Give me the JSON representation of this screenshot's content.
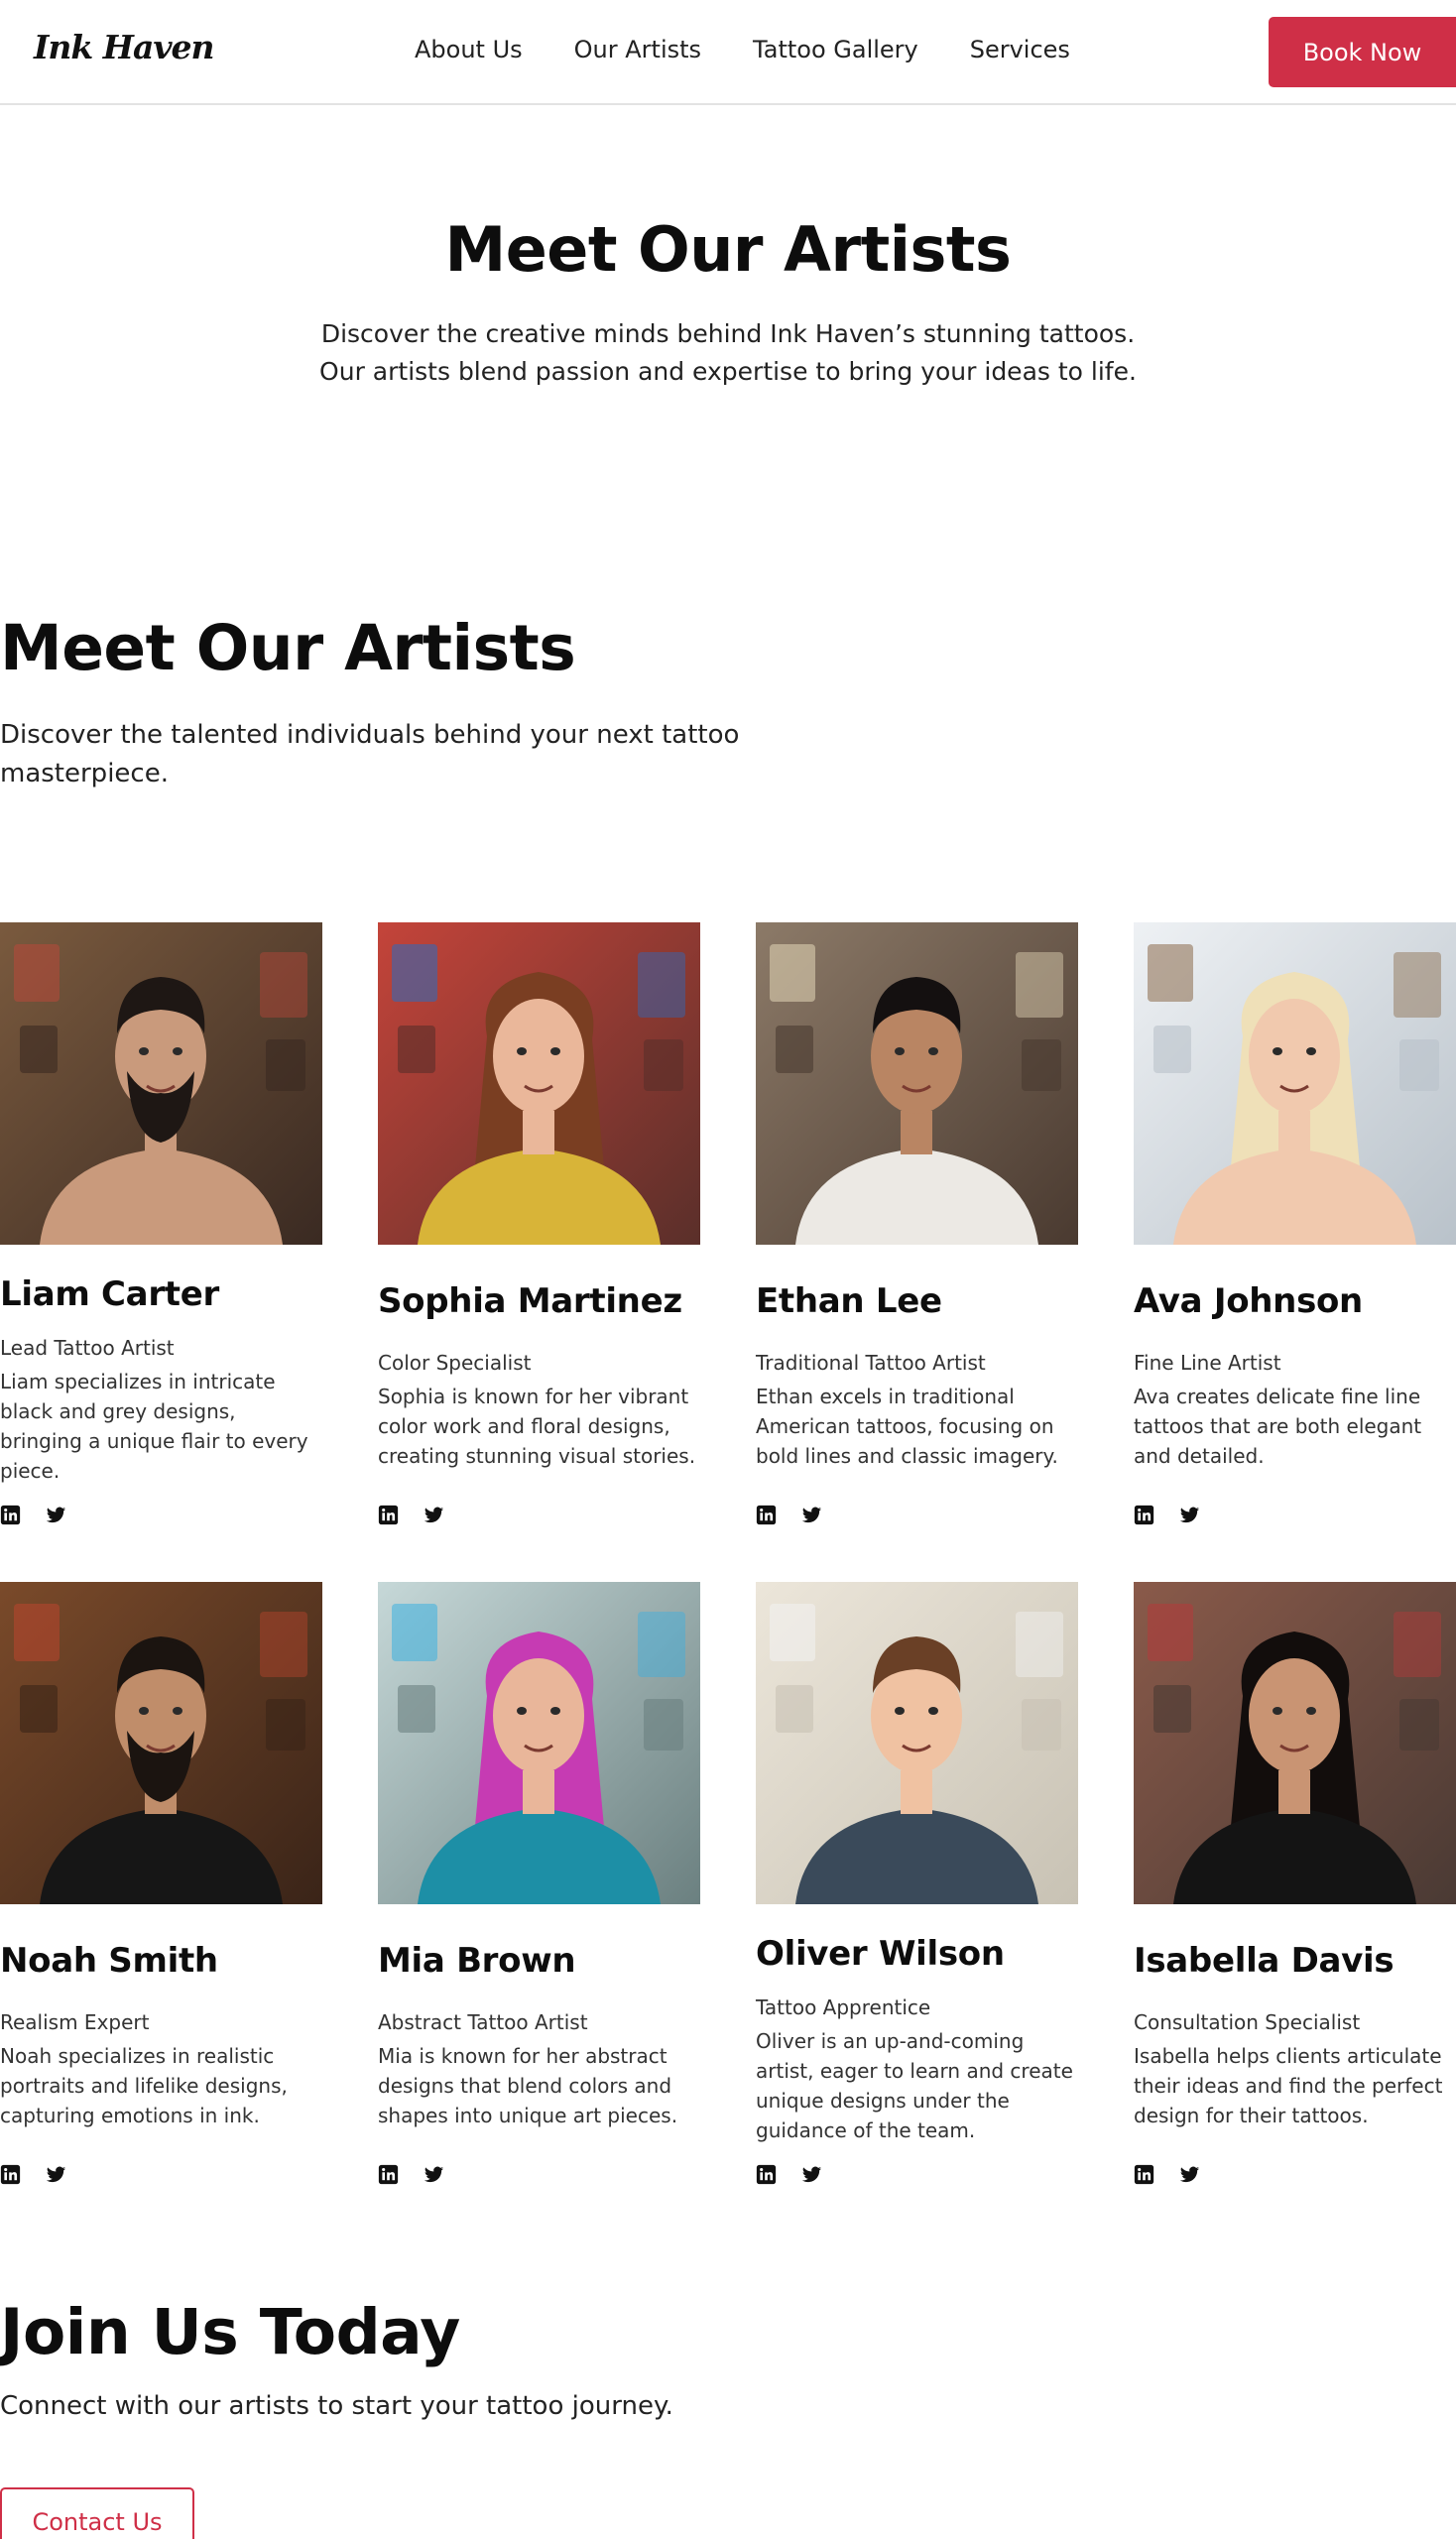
{
  "brand": {
    "logo": "Ink Haven"
  },
  "nav": {
    "links": [
      "About Us",
      "Our Artists",
      "Tattoo Gallery",
      "Services"
    ],
    "cta": "Book Now"
  },
  "hero": {
    "title": "Meet Our Artists",
    "subtitle": "Discover the creative minds behind Ink Haven’s stunning tattoos. Our artists blend passion and expertise to bring your ideas to life."
  },
  "section": {
    "title": "Meet Our Artists",
    "subtitle": "Discover the talented individuals behind your next tattoo masterpiece."
  },
  "artists": [
    {
      "name": "Liam Carter",
      "role": "Lead Tattoo Artist",
      "bio": "Liam specializes in intricate black and grey designs, bringing a unique flair to every piece.",
      "photo": "portrait-bearded-tattooed-man"
    },
    {
      "name": "Sophia Martinez",
      "role": "Color Specialist",
      "bio": "Sophia is known for her vibrant color work and floral designs, creating stunning visual stories.",
      "photo": "portrait-woman-long-wavy-hair"
    },
    {
      "name": "Ethan Lee",
      "role": "Traditional Tattoo Artist",
      "bio": "Ethan excels in traditional American tattoos, focusing on bold lines and classic imagery.",
      "photo": "portrait-smiling-man-tank-top"
    },
    {
      "name": "Ava Johnson",
      "role": "Fine Line Artist",
      "bio": "Ava creates delicate fine line tattoos that are both elegant and detailed.",
      "photo": "portrait-woman-short-blonde-hair"
    },
    {
      "name": "Noah Smith",
      "role": "Realism Expert",
      "bio": "Noah specializes in realistic portraits and lifelike designs, capturing emotions in ink.",
      "photo": "portrait-bearded-man-black-tee"
    },
    {
      "name": "Mia Brown",
      "role": "Abstract Tattoo Artist",
      "bio": "Mia is known for her abstract designs that blend colors and shapes into unique art pieces.",
      "photo": "portrait-woman-pink-blue-hair"
    },
    {
      "name": "Oliver Wilson",
      "role": "Tattoo Apprentice",
      "bio": "Oliver is an up-and-coming artist, eager to learn and create unique designs under the guidance of the team.",
      "photo": "portrait-young-man-denim-jacket"
    },
    {
      "name": "Isabella Davis",
      "role": "Consultation Specialist",
      "bio": "Isabella helps clients articulate their ideas and find the perfect design for their tattoos.",
      "photo": "portrait-woman-long-dark-hair"
    }
  ],
  "social_icons": [
    "linkedin-icon",
    "twitter-icon"
  ],
  "join": {
    "title": "Join Us Today",
    "subtitle": "Connect with our artists to start your tattoo journey.",
    "cta": "Contact Us"
  },
  "colors": {
    "accent": "#cf2f47",
    "text": "#111111",
    "muted": "#333333"
  }
}
